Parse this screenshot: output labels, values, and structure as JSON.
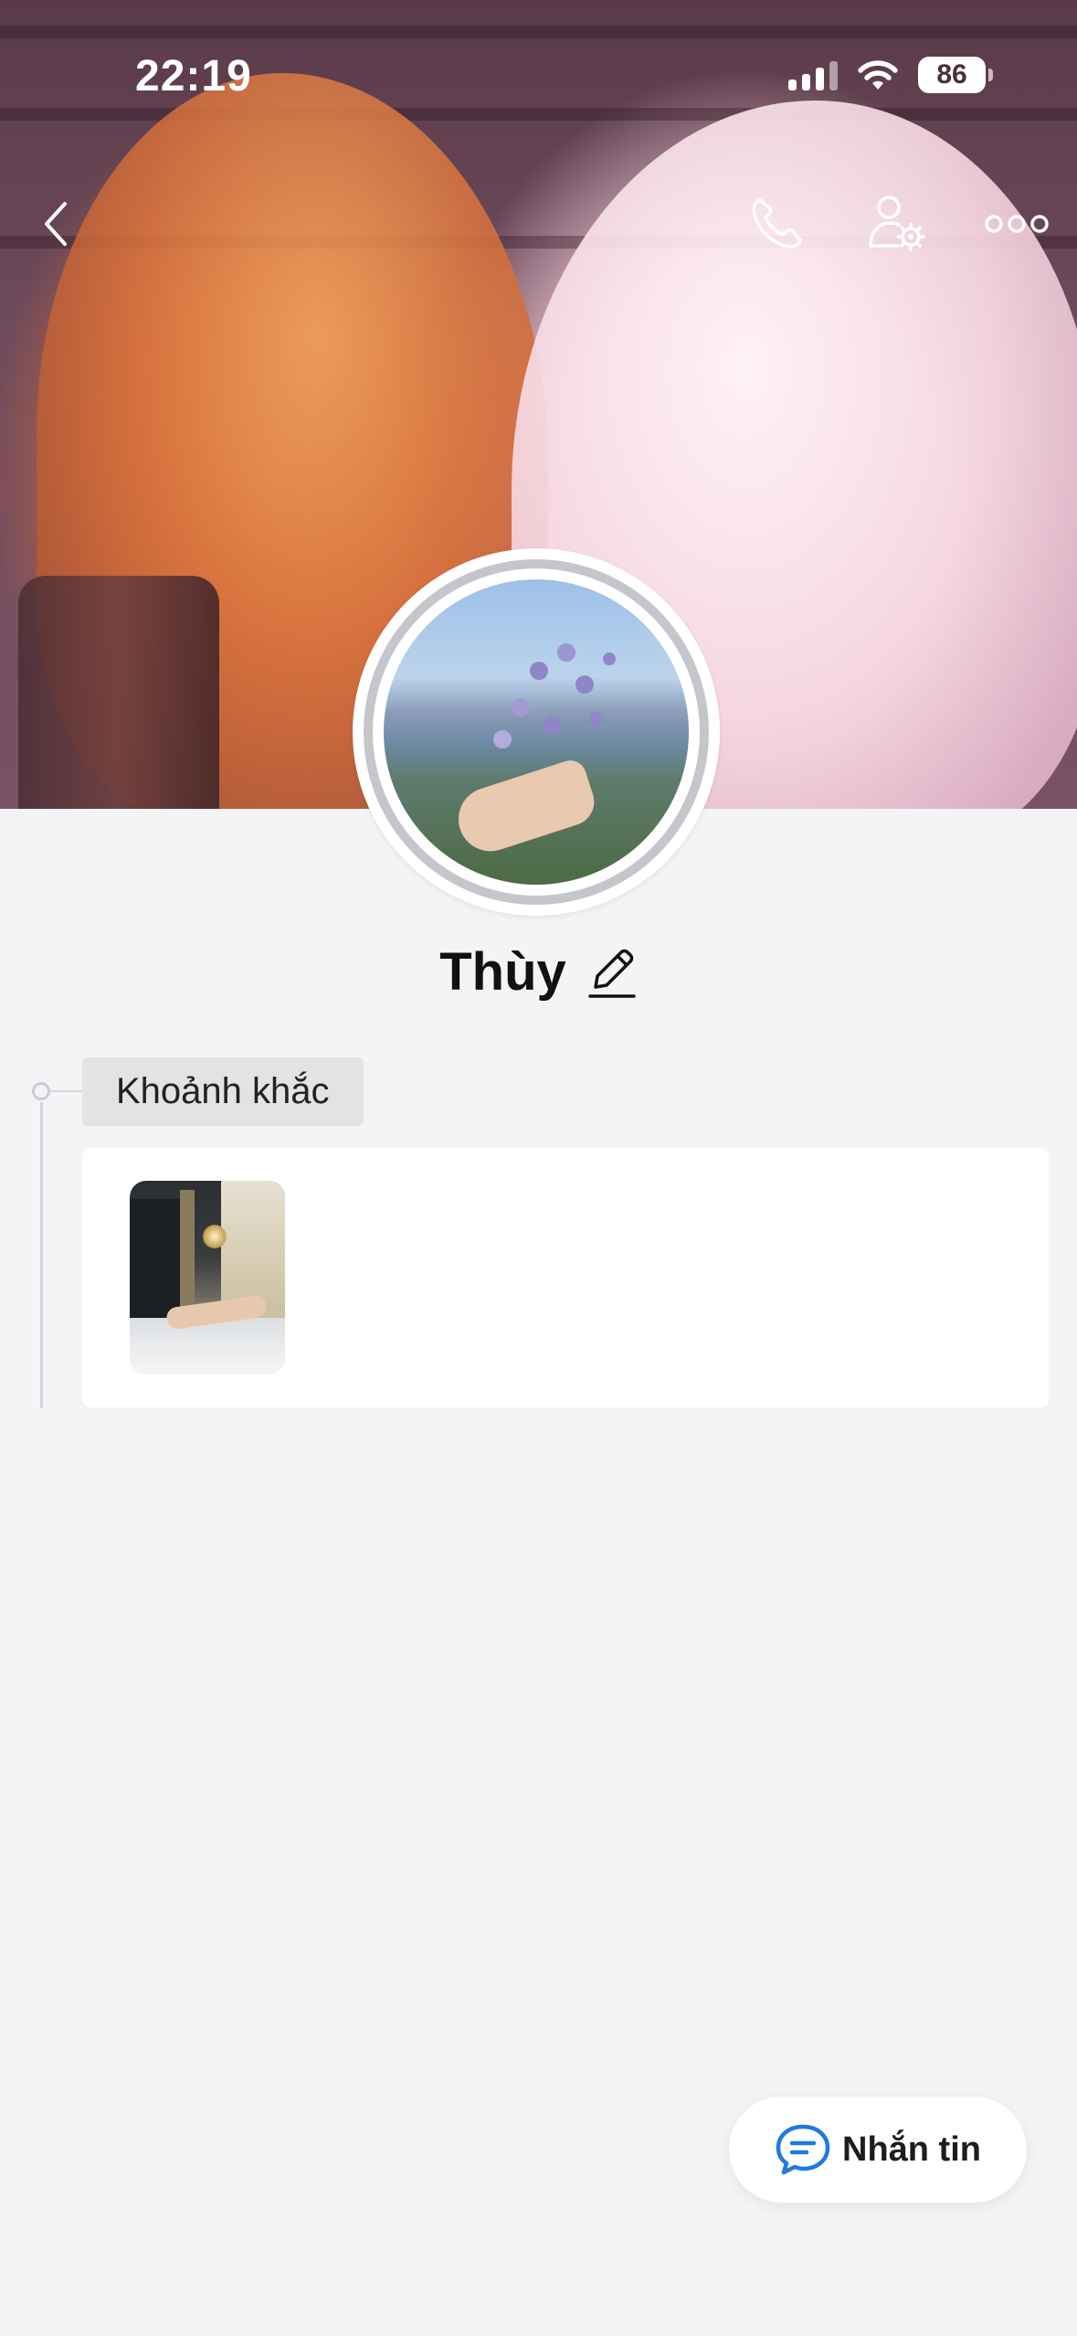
{
  "status_bar": {
    "time": "22:19",
    "battery": "86"
  },
  "nav": {
    "back_icon": "chevron-left-icon",
    "call_icon": "phone-icon",
    "settings_icon": "user-settings-icon",
    "more_icon": "more-dots-icon"
  },
  "profile": {
    "name": "Thùy"
  },
  "moments": {
    "label": "Khoảnh khắc",
    "items_count_visible": 1
  },
  "actions": {
    "message_label": "Nhắn tin",
    "message_icon": "chat-bubble-icon"
  },
  "colors": {
    "accent": "#1f7ae0",
    "background": "#f3f4f6",
    "card": "#ffffff",
    "tag_bg": "#e2e3e5"
  }
}
